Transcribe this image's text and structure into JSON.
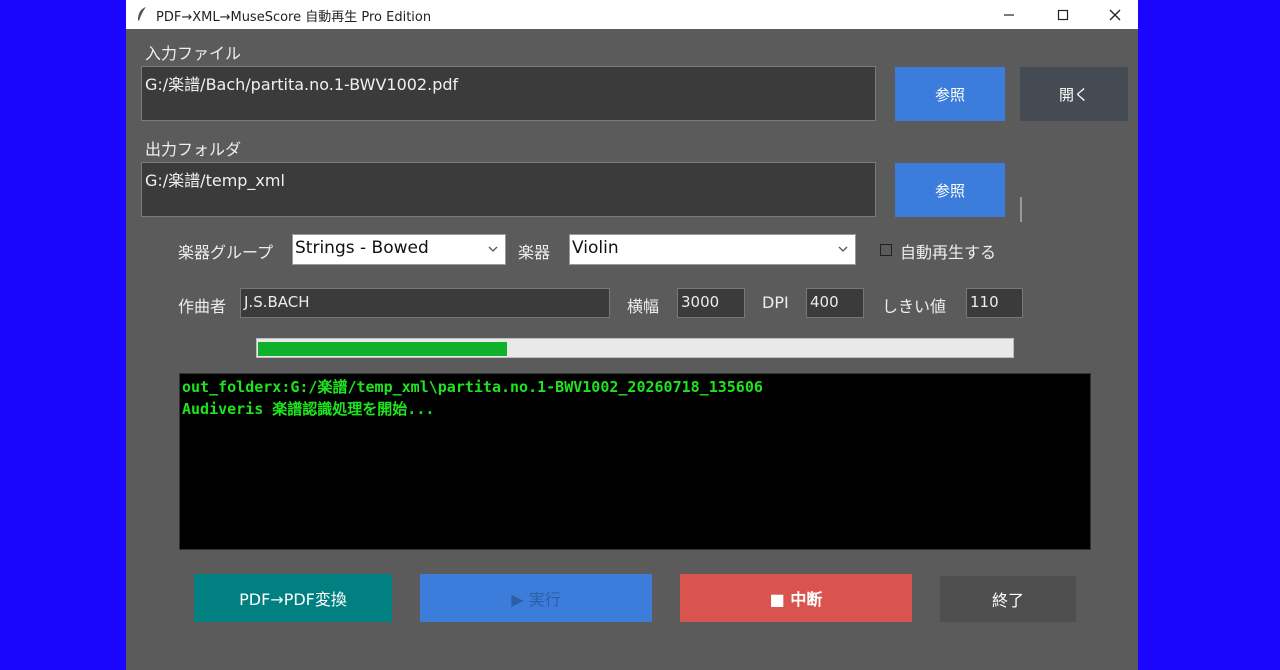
{
  "window": {
    "title": "PDF→XML→MuseScore 自動再生 Pro Edition"
  },
  "input_file": {
    "label": "入力ファイル",
    "value": "G:/楽譜/Bach/partita.no.1-BWV1002.pdf",
    "browse_label": "参照",
    "open_label": "開く"
  },
  "output_folder": {
    "label": "出力フォルダ",
    "value": "G:/楽譜/temp_xml",
    "browse_label": "参照"
  },
  "options": {
    "group_label": "楽器グループ",
    "group_value": "Strings - Bowed",
    "instrument_label": "楽器",
    "instrument_value": "Violin",
    "autoplay_label": "自動再生する",
    "autoplay_checked": false
  },
  "params": {
    "composer_label": "作曲者",
    "composer_value": "J.S.BACH",
    "width_label": "横幅",
    "width_value": "3000",
    "dpi_label": "DPI",
    "dpi_value": "400",
    "threshold_label": "しきい値",
    "threshold_value": "110"
  },
  "progress": {
    "fraction": 0.33,
    "color": "#0fb02a"
  },
  "log": {
    "lines": [
      "out_folderx:G:/楽譜/temp_xml\\partita.no.1-BWV1002_20260718_135606",
      "Audiveris 楽譜認識処理を開始..."
    ]
  },
  "buttons": {
    "convert_label": "PDF→PDF変換",
    "run_label": "▶ 実行",
    "stop_label": "■ 中断",
    "quit_label": "終了"
  },
  "colors": {
    "background": "#1a05ff",
    "window": "#5b5b5b",
    "accent_blue": "#3c7ddb",
    "teal": "#008080",
    "red": "#d9534f",
    "log_text": "#1fe31f"
  },
  "icons": {
    "app": "feather-icon",
    "minimize": "minimize-icon",
    "maximize": "maximize-icon",
    "close": "close-icon",
    "dropdown": "chevron-down-icon"
  }
}
